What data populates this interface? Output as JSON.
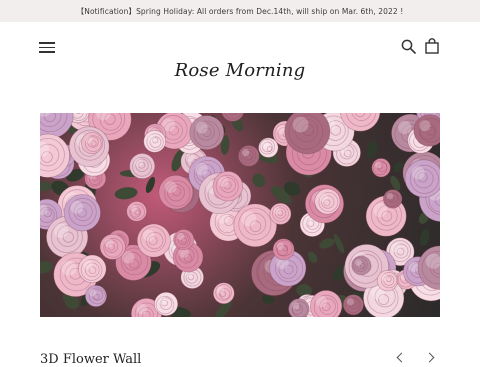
{
  "announcement": {
    "text": "【Notification】Spring Holiday: All orders from Dec.14th, will ship on Mar. 6th, 2022 !"
  },
  "header": {
    "brand": "Rose Morning",
    "icons": [
      "hamburger-menu-icon",
      "search-icon",
      "shopping-bag-icon"
    ]
  },
  "hero": {
    "description": "Wall of pink, white and lavender roses"
  },
  "product": {
    "title": "3D Flower Wall"
  },
  "colors": {
    "announcement_bg": "#f3eeee",
    "text": "#2b2b2b",
    "rose_pink": "#e6a6bd",
    "rose_light": "#f2d3de",
    "rose_dark": "#9a5a6e",
    "leaf": "#2f3a2c"
  }
}
